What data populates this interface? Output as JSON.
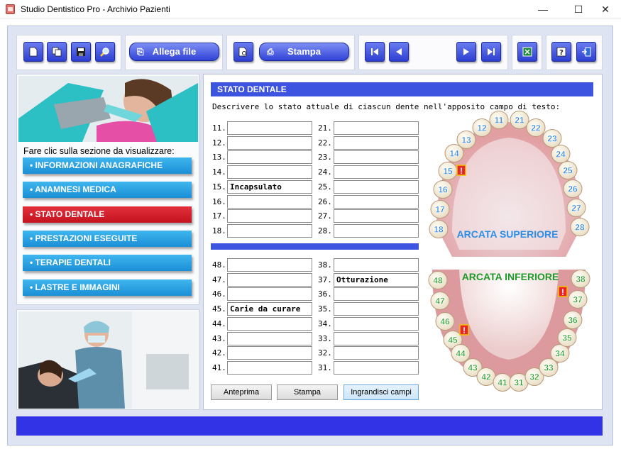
{
  "window": {
    "title": "Studio Dentistico Pro - Archivio Pazienti",
    "minimize": "—",
    "maximize": "☐",
    "close": "✕"
  },
  "toolbar": {
    "allega_label": "Allega file",
    "stampa_label": "Stampa",
    "icons": [
      "new-document-icon",
      "copy-icon",
      "save-icon",
      "search-icon",
      "paperclip-icon",
      "preview-icon",
      "printer-icon",
      "first-record-icon",
      "previous-record-icon",
      "next-record-icon",
      "last-record-icon",
      "excel-icon",
      "help-icon",
      "exit-icon"
    ]
  },
  "nav": {
    "prompt": "Fare clic sulla sezione da visualizzare:",
    "items": [
      {
        "label": "• INFORMAZIONI ANAGRAFICHE",
        "active": false
      },
      {
        "label": "• ANAMNESI MEDICA",
        "active": false
      },
      {
        "label": "• STATO DENTALE",
        "active": true
      },
      {
        "label": "• PRESTAZIONI ESEGUITE",
        "active": false
      },
      {
        "label": "• TERAPIE DENTALI",
        "active": false
      },
      {
        "label": "• LASTRE E IMMAGINI",
        "active": false
      }
    ]
  },
  "section": {
    "title": "STATO DENTALE",
    "instructions": "Descrivere lo stato attuale di ciascun dente nell'apposito campo di testo:"
  },
  "upper_left": [
    {
      "label": "11.",
      "value": ""
    },
    {
      "label": "12.",
      "value": ""
    },
    {
      "label": "13.",
      "value": ""
    },
    {
      "label": "14.",
      "value": ""
    },
    {
      "label": "15.",
      "value": "Incapsulato"
    },
    {
      "label": "16.",
      "value": ""
    },
    {
      "label": "17.",
      "value": ""
    },
    {
      "label": "18.",
      "value": ""
    }
  ],
  "upper_right": [
    {
      "label": "21.",
      "value": ""
    },
    {
      "label": "22.",
      "value": ""
    },
    {
      "label": "23.",
      "value": ""
    },
    {
      "label": "24.",
      "value": ""
    },
    {
      "label": "25.",
      "value": ""
    },
    {
      "label": "26.",
      "value": ""
    },
    {
      "label": "27.",
      "value": ""
    },
    {
      "label": "28.",
      "value": ""
    }
  ],
  "lower_left": [
    {
      "label": "48.",
      "value": ""
    },
    {
      "label": "47.",
      "value": ""
    },
    {
      "label": "46.",
      "value": ""
    },
    {
      "label": "45.",
      "value": "Carie da curare"
    },
    {
      "label": "44.",
      "value": ""
    },
    {
      "label": "43.",
      "value": ""
    },
    {
      "label": "42.",
      "value": ""
    },
    {
      "label": "41.",
      "value": ""
    }
  ],
  "lower_right": [
    {
      "label": "38.",
      "value": ""
    },
    {
      "label": "37.",
      "value": "Otturazione"
    },
    {
      "label": "36.",
      "value": ""
    },
    {
      "label": "35.",
      "value": ""
    },
    {
      "label": "34.",
      "value": ""
    },
    {
      "label": "33.",
      "value": ""
    },
    {
      "label": "32.",
      "value": ""
    },
    {
      "label": "31.",
      "value": ""
    }
  ],
  "buttons": {
    "anteprima": "Anteprima",
    "stampa": "Stampa",
    "ingrandisci": "Ingrandisci campi"
  },
  "diagram": {
    "upper_label": "ARCATA SUPERIORE",
    "lower_label": "ARCATA INFERIORE",
    "upper_teeth": [
      "11",
      "12",
      "13",
      "14",
      "15",
      "16",
      "17",
      "18",
      "21",
      "22",
      "23",
      "24",
      "25",
      "26",
      "27",
      "28"
    ],
    "lower_teeth": [
      "48",
      "47",
      "46",
      "45",
      "44",
      "43",
      "42",
      "41",
      "31",
      "32",
      "33",
      "34",
      "35",
      "36",
      "37",
      "38"
    ],
    "alert_mark": "!",
    "alert_teeth": [
      "15",
      "45",
      "37"
    ],
    "colors": {
      "upper_number": "#1f7fe0",
      "lower_number": "#1f9a2a",
      "alert": "#e8262a",
      "gum": "#e6a4a4"
    }
  },
  "colors": {
    "accent": "#3d54e0",
    "nav_blue": "#1a8fd6",
    "nav_active": "#d81e2a",
    "statusbar": "#3232e6"
  }
}
